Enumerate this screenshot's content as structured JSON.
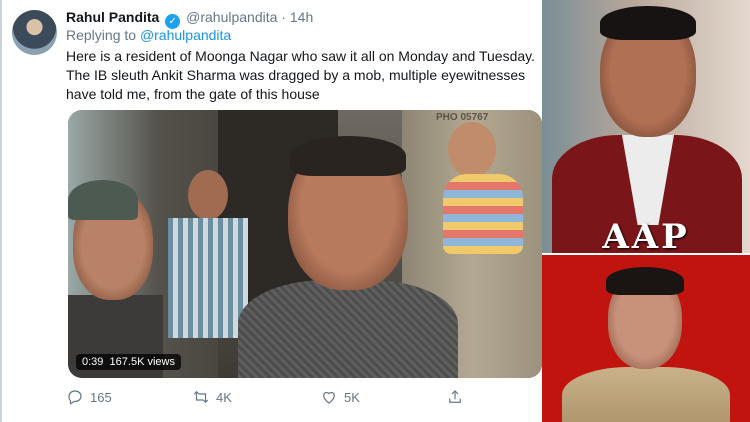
{
  "tweet": {
    "author_name": "Rahul Pandita",
    "handle": "@rahulpandita",
    "separator": "·",
    "time": "14h",
    "replying_prefix": "Replying to",
    "replying_to": "@rahulpandita",
    "text": "Here is a resident of Moonga Nagar who saw it all on Monday and Tuesday. The IB sleuth Ankit Sharma was dragged by a mob, multiple eyewitnesses have told me, from the gate of this house",
    "video": {
      "duration": "0:39",
      "views": "167.5K views",
      "wall_sign": "PHO 05767"
    },
    "actions": {
      "replies": "165",
      "retweets": "4K",
      "likes": "5K",
      "share": ""
    }
  },
  "side_panel": {
    "party_label": "AAP"
  },
  "colors": {
    "link_blue": "#1b95e0",
    "verified_blue": "#1da1f2",
    "muted_gray": "#657786",
    "banner_red": "#c2140f"
  },
  "icons": [
    "verified-badge-icon",
    "reply-icon",
    "retweet-icon",
    "like-icon",
    "share-icon"
  ]
}
